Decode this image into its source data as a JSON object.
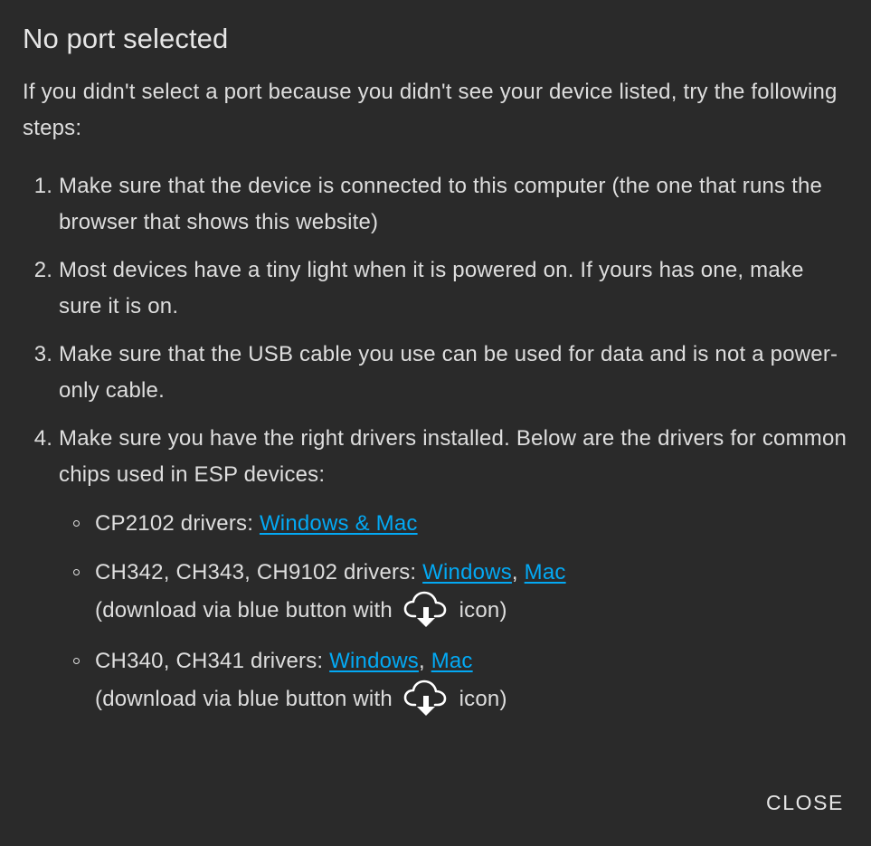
{
  "dialog": {
    "title": "No port selected",
    "intro": "If you didn't select a port because you didn't see your device listed, try the following steps:",
    "steps": [
      "Make sure that the device is connected to this computer (the one that runs the browser that shows this website)",
      "Most devices have a tiny light when it is powered on. If yours has one, make sure it is on.",
      "Make sure that the USB cable you use can be used for data and is not a power-only cable.",
      "Make sure you have the right drivers installed. Below are the drivers for common chips used in ESP devices:"
    ],
    "drivers": [
      {
        "label": "CP2102 drivers: ",
        "links": [
          "Windows & Mac"
        ]
      },
      {
        "label": "CH342, CH343, CH9102 drivers: ",
        "links": [
          "Windows",
          "Mac"
        ],
        "separator": ", ",
        "note_before": "(download via blue button with ",
        "note_icon": "cloud-download-icon",
        "note_after": " icon)"
      },
      {
        "label": "CH340, CH341 drivers: ",
        "links": [
          "Windows",
          "Mac"
        ],
        "separator": ", ",
        "note_before": "(download via blue button with ",
        "note_icon": "cloud-download-icon",
        "note_after": " icon)"
      }
    ],
    "close_label": "CLOSE"
  },
  "colors": {
    "background": "#2a2a2a",
    "text": "#dedede",
    "link": "#03a9f4"
  }
}
